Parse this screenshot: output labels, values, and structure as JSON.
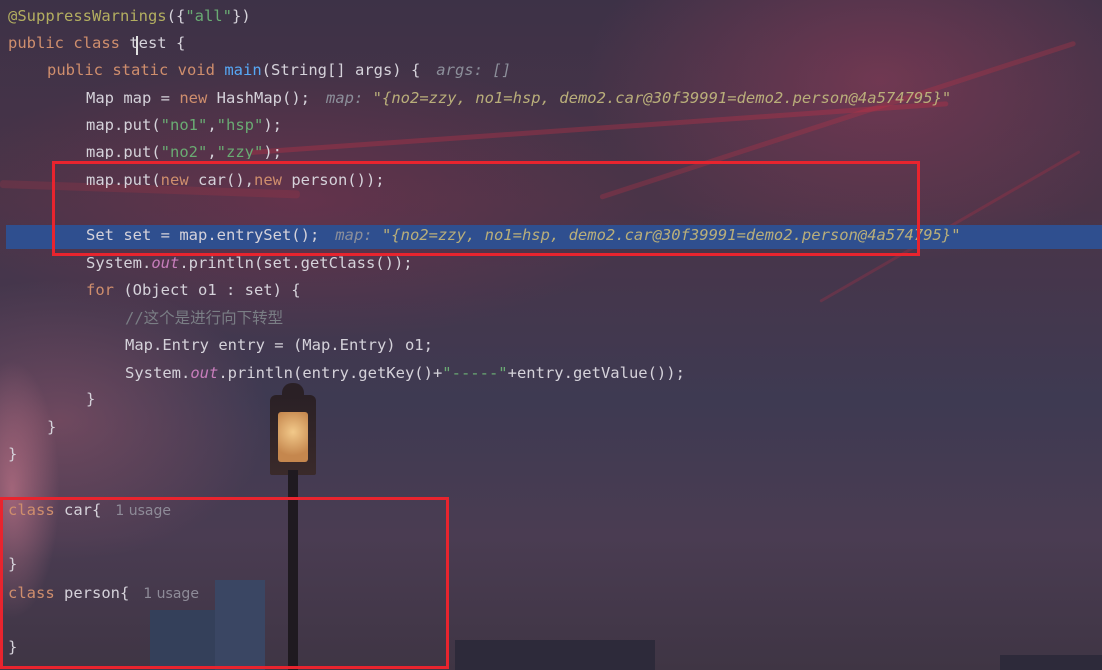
{
  "code": {
    "l1_annotation": "@SuppressWarnings",
    "l1_open": "({",
    "l1_string": "\"all\"",
    "l1_close": "})",
    "l2_kw": "public class",
    "l2_name": " test {",
    "l3_kw": "public static void",
    "l3_method": "main",
    "l3_rest": "(String[] args) {",
    "l3_hint": "args: []",
    "l4_a": "Map map = ",
    "l4_kw": "new",
    "l4_b": " HashMap();",
    "l4_hint_label": "map: ",
    "l4_hint_value": "\"{no2=zzy, no1=hsp, demo2.car@30f39991=demo2.person@4a574795}\"",
    "l5_a": "map.put(",
    "l5_s1": "\"no1\"",
    "l5_comma": ",",
    "l5_s2": "\"hsp\"",
    "l5_end": ");",
    "l6_a": "map.put(",
    "l6_s1": "\"no2\"",
    "l6_comma": ",",
    "l6_s2": "\"zzy\"",
    "l6_end": ");",
    "l7_a": "map.put(",
    "l7_kw1": "new",
    "l7_b": " car(),",
    "l7_kw2": "new",
    "l7_c": " person());",
    "l9_code": "Set set = map.entrySet();",
    "l9_hint_label": "map: ",
    "l9_hint_value": "\"{no2=zzy, no1=hsp, demo2.car@30f39991=demo2.person@4a574795}\"",
    "l10_a": "System.",
    "l10_out": "out",
    "l10_b": ".println(set.getClass());",
    "l11_kw": "for",
    "l11_rest": " (Object o1 : set) {",
    "l12_comment": "//这个是进行向下转型",
    "l13_code": "Map.Entry entry = (Map.Entry) o1;",
    "l14_a": "System.",
    "l14_out": "out",
    "l14_b": ".println(entry.getKey()+",
    "l14_str": "\"-----\"",
    "l14_c": "+entry.getValue());",
    "brace": "}",
    "car_kw": "class",
    "car_name": " car{",
    "car_usage": "1 usage",
    "person_kw": "class",
    "person_name": " person{",
    "person_usage": "1 usage"
  },
  "colors": {
    "highlight_line": "#2f4f8f",
    "red_box": "#e8242e"
  }
}
